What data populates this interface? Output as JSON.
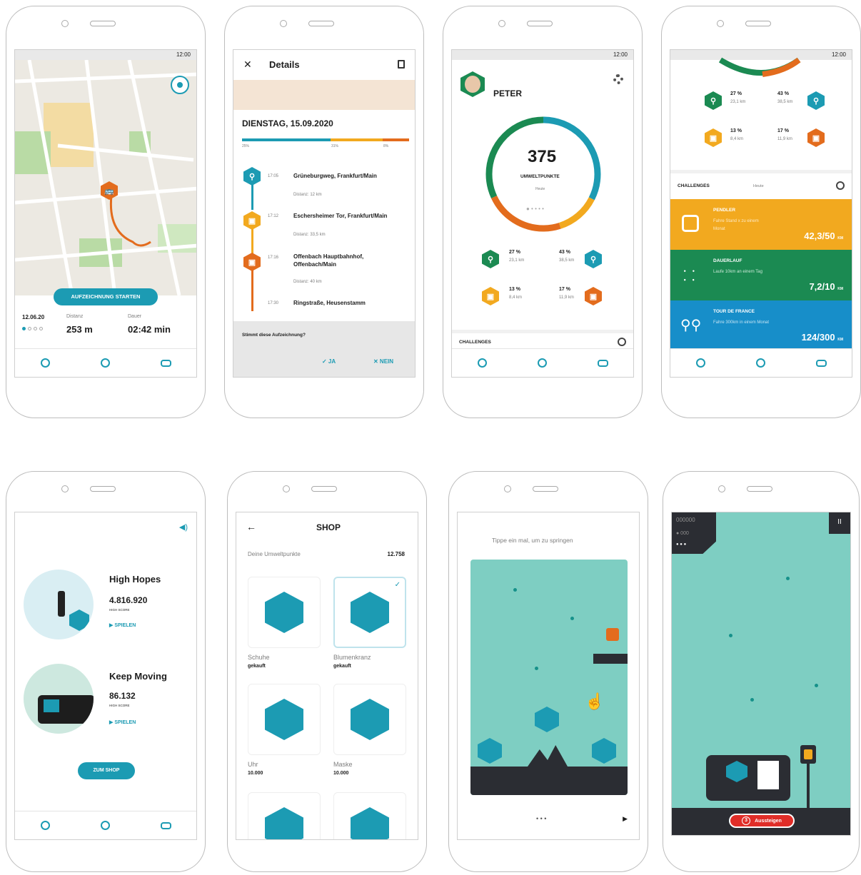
{
  "s1": {
    "time": "12:00",
    "button": "AUFZEICHNUNG STARTEN",
    "date": "12.06.20",
    "dist_label": "Distanz",
    "dist": "253 m",
    "dur_label": "Dauer",
    "dur": "02:42 min"
  },
  "s2": {
    "title": "Details",
    "date": "DIENSTAG, 15.09.2020",
    "pct": [
      "25%",
      "31%",
      "8%"
    ],
    "stops": [
      {
        "time": "17:05",
        "place": "Grüneburgweg, Frankfurt/Main",
        "dist": "Distanz: 12 km"
      },
      {
        "time": "17:12",
        "place": "Eschersheimer Tor, Frankfurt/Main",
        "dist": "Distanz: 33,5 km"
      },
      {
        "time": "17:16",
        "place": "Offenbach Hauptbahnhof, Offenbach/Main",
        "dist": "Distanz: 40 km"
      },
      {
        "time": "17:30",
        "place": "Ringstraße, Heusenstamm"
      }
    ],
    "question": "Stimmt diese Aufzeichnung?",
    "yes": "✓ JA",
    "no": "✕ NEIN"
  },
  "s3": {
    "time": "12:00",
    "name": "PETER",
    "points": "375",
    "points_label": "UMWELTPUNKTE",
    "sub": "Heute",
    "stats": [
      {
        "p": "27 %",
        "d": "23,1 km"
      },
      {
        "p": "43 %",
        "d": "38,5 km"
      },
      {
        "p": "13 %",
        "d": "8,4 km"
      },
      {
        "p": "17 %",
        "d": "11,9 km"
      }
    ],
    "challenges": "CHALLENGES"
  },
  "s4": {
    "time": "12:00",
    "stats": [
      {
        "p": "27 %",
        "d": "23,1 km"
      },
      {
        "p": "43 %",
        "d": "38,5 km"
      },
      {
        "p": "13 %",
        "d": "8,4 km"
      },
      {
        "p": "17 %",
        "d": "11,9 km"
      }
    ],
    "challenges": "CHALLENGES",
    "heute": "Heute",
    "items": [
      {
        "title": "PENDLER",
        "desc": "Fahre Stand x zu einem Monat",
        "value": "42,3/50",
        "unit": "KM",
        "color": "#f2a91f"
      },
      {
        "title": "DAUERLAUF",
        "desc": "Laufe 10km an einem Tag",
        "value": "7,2/10",
        "unit": "KM",
        "color": "#1b8a52"
      },
      {
        "title": "TOUR DE FRANCE",
        "desc": "Fahre 300km in einem Monat",
        "value": "124/300",
        "unit": "KM",
        "color": "#178ec9"
      }
    ]
  },
  "s5": {
    "games": [
      {
        "name": "High Hopes",
        "score": "4.816.920",
        "score_label": "HIGH SCORE",
        "play": "▶ SPIELEN"
      },
      {
        "name": "Keep Moving",
        "score": "86.132",
        "score_label": "HIGH SCORE",
        "play": "▶ SPIELEN"
      }
    ],
    "shop_button": "ZUM SHOP"
  },
  "s6": {
    "title": "SHOP",
    "points_label": "Deine Umweltpunkte",
    "points": "12.758",
    "items": [
      {
        "name": "Schuhe",
        "status": "gekauft"
      },
      {
        "name": "Blumenkranz",
        "status": "gekauft"
      },
      {
        "name": "Uhr",
        "status": "10.000"
      },
      {
        "name": "Maske",
        "status": "10.000"
      }
    ]
  },
  "s7": {
    "hint": "Tippe ein mal, um zu springen"
  },
  "s8": {
    "score": "000000",
    "exit": "Aussteigen",
    "exit_count": "3"
  }
}
